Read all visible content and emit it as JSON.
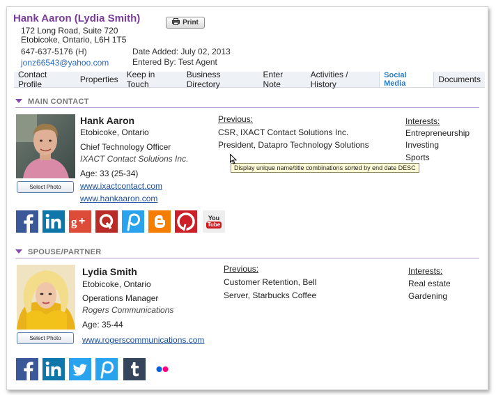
{
  "header": {
    "name": "Hank Aaron (Lydia Smith)",
    "address1": "172 Long Road, Suite 720",
    "address2": "Etobicoke, Ontario, L6H 1T5",
    "phone": "647-637-5176 (H)",
    "email": "jonz66543@yahoo.com",
    "date_added": "Date Added: July 02, 2013",
    "entered_by": "Entered By: Test Agent",
    "print_label": "Print"
  },
  "tabs": [
    {
      "label": "Contact Profile",
      "active": false
    },
    {
      "label": "Properties",
      "active": false
    },
    {
      "label": "Keep in Touch",
      "active": false
    },
    {
      "label": "Business Directory",
      "active": false
    },
    {
      "label": "Enter Note",
      "active": false
    },
    {
      "label": "Activities / History",
      "active": false
    },
    {
      "label": "Social Media",
      "active": true
    },
    {
      "label": "Documents",
      "active": false
    }
  ],
  "main_contact": {
    "section_title": "MAIN CONTACT",
    "name": "Hank Aaron",
    "city": "Etobicoke, Ontario",
    "title": "Chief Technology Officer",
    "company": "IXACT Contact Solutions Inc.",
    "age": "Age: 33 (25-34)",
    "link1": "www.ixactcontact.com",
    "link2": "www.hankaaron.com",
    "select_photo": "Select Photo",
    "previous_label": "Previous:",
    "previous": [
      "CSR, IXACT Contact Solutions Inc.",
      "President, Datapro Technology Solutions"
    ],
    "interests_label": "Interests:",
    "interests": [
      "Entrepreneurship",
      "Investing",
      "Sports"
    ],
    "tooltip": "Display unique name/title combinations sorted by end date DESC",
    "social": [
      "facebook",
      "linkedin",
      "google-plus",
      "quora",
      "pinterest-p",
      "blogger",
      "pinterest",
      "youtube"
    ],
    "youtube_top": "You",
    "youtube_bottom": "Tube"
  },
  "spouse": {
    "section_title": "SPOUSE/PARTNER",
    "name": "Lydia Smith",
    "city": "Etobicoke, Ontario",
    "title": "Operations Manager",
    "company": "Rogers Communications",
    "age": "Age: 35-44",
    "link1": "www.rogerscommunications.com",
    "select_photo": "Select Photo",
    "previous_label": "Previous:",
    "previous": [
      "Customer Retention, Bell",
      "Server, Starbucks Coffee"
    ],
    "interests_label": "Interests:",
    "interests": [
      "Real estate",
      "Gardening"
    ],
    "social": [
      "facebook",
      "linkedin",
      "twitter",
      "pinterest-p",
      "tumblr",
      "flickr"
    ]
  },
  "colors": {
    "accent_purple": "#7a3b9c",
    "active_tab": "#2a7cc7",
    "facebook": "#3b5998",
    "linkedin": "#0e76a8",
    "google_plus": "#dd4b39",
    "quora": "#b92b27",
    "blogger": "#f57d00",
    "pinterest": "#cb2027",
    "twitter": "#2aa3ef",
    "tumblr": "#35465c"
  }
}
